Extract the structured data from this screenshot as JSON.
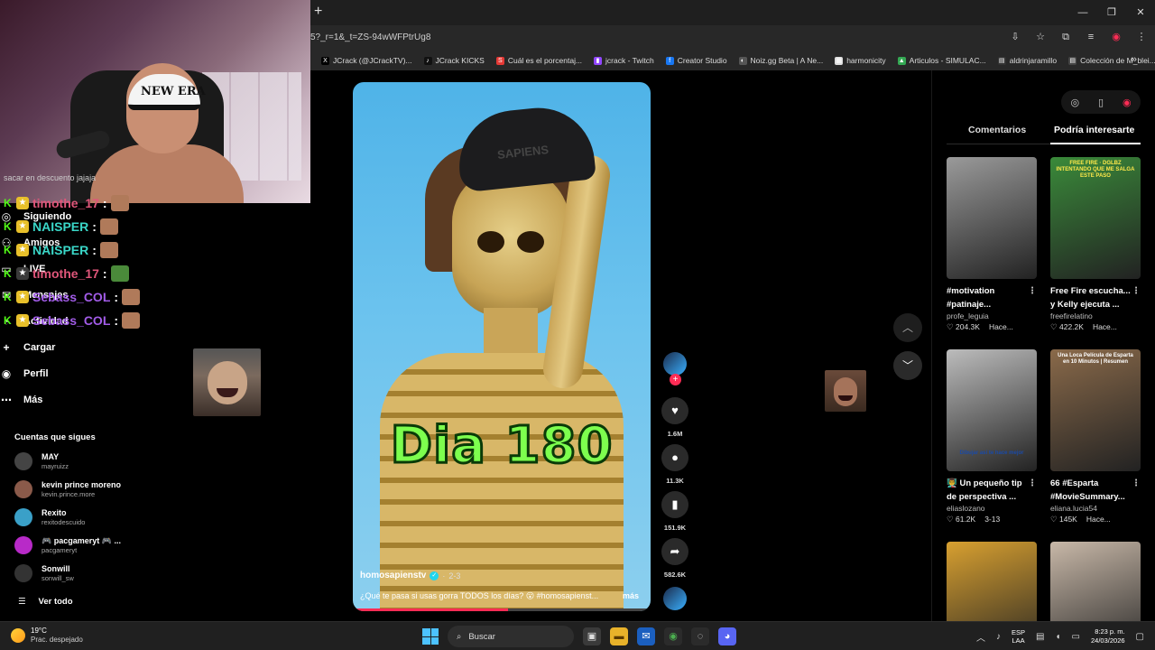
{
  "browser": {
    "url": "5?_r=1&_t=ZS-94wWFPtrUg8",
    "bookmarks": [
      {
        "label": "JCrack (@JCrackTV)...",
        "icon": "x-icon",
        "color": "#000000"
      },
      {
        "label": "JCrack KICKS",
        "icon": "tiktok-icon",
        "color": "#111111"
      },
      {
        "label": "Cuál es el porcentaj...",
        "icon": "s-icon",
        "color": "#e53935"
      },
      {
        "label": "jcrack - Twitch",
        "icon": "twitch-icon",
        "color": "#9146ff"
      },
      {
        "label": "Creator Studio",
        "icon": "facebook-icon",
        "color": "#1877f2"
      },
      {
        "label": "Noiz.gg Beta | A Ne...",
        "icon": "noiz-icon",
        "color": "#555555"
      },
      {
        "label": "harmonicity",
        "icon": "harmonicity-icon",
        "color": "#dddddd"
      },
      {
        "label": "Articulos - SIMULAC...",
        "icon": "drive-icon",
        "color": "#34a853"
      },
      {
        "label": "aldrinjaramillo",
        "icon": "user-icon",
        "color": "#333333"
      },
      {
        "label": "Colección de M_blei...",
        "icon": "doc-icon",
        "color": "#444444"
      }
    ]
  },
  "sidebar": {
    "nav": [
      {
        "label": "Siguiendo",
        "icon": "following-icon"
      },
      {
        "label": "Amigos",
        "icon": "friends-icon"
      },
      {
        "label": "LIVE",
        "icon": "live-icon"
      },
      {
        "label": "Mensajes",
        "icon": "messages-icon"
      },
      {
        "label": "Actividad",
        "icon": "activity-icon"
      },
      {
        "label": "Cargar",
        "icon": "upload-icon"
      },
      {
        "label": "Perfil",
        "icon": "profile-icon"
      },
      {
        "label": "Más",
        "icon": "more-icon"
      }
    ],
    "following_title": "Cuentas que sigues",
    "accounts": [
      {
        "name": "MAY",
        "handle": "mayruizz",
        "color": "#444444"
      },
      {
        "name": "kevin prince moreno",
        "handle": "kevin.prince.more",
        "color": "#8a5a4a"
      },
      {
        "name": "Rexito",
        "handle": "rexitodescuido",
        "color": "#3aa0c8"
      },
      {
        "name": "🎮 pacgameryt 🎮 ...",
        "handle": "pacgameryt",
        "color": "#b82ac8"
      },
      {
        "name": "Sonwill",
        "handle": "sonwill_sw",
        "color": "#333333"
      }
    ],
    "see_all": "Ver todo"
  },
  "chat": {
    "top_line": "sacar en descuento jajaja",
    "messages": [
      {
        "user": "timothe_17",
        "color": "#e0567a"
      },
      {
        "user": "NAISPER",
        "color": "#3ad7c8"
      },
      {
        "user": "NAISPER",
        "color": "#3ad7c8"
      },
      {
        "user": "timothe_17",
        "color": "#e0567a"
      },
      {
        "user": "Sebass_COL",
        "color": "#a25ce8"
      },
      {
        "user": "Sebass_COL",
        "color": "#a25ce8"
      }
    ]
  },
  "video": {
    "overlay_text": "Dia 180",
    "cap_text": "SAPIENS",
    "author": "homosapienstv",
    "date": "2-3",
    "description": "¿Qué te pasa si usas gorra TODOS los días? 😮 #homosapienst...",
    "more": "más",
    "progress": 0.52,
    "likes": "1.6M",
    "comments": "11.3K",
    "saves": "151.9K",
    "shares": "582.6K"
  },
  "right_panel": {
    "tabs": [
      "Comentarios",
      "Podría interesarte"
    ],
    "active_tab": 1,
    "cards": [
      {
        "title": "#motivation #patinaje...",
        "user": "profe_leguia",
        "likes": "204.3K",
        "when": "Hace...",
        "thumb_caption": "",
        "thumb": "#9a9a9a"
      },
      {
        "title": "Free Fire escucha... y Kelly ejecuta ...",
        "user": "freefirelatino",
        "likes": "422.2K",
        "when": "Hace...",
        "thumb_caption": "FREE FIRE · DGLBZ INTENTANDO QUE ME SALGA ESTE PASO",
        "thumb": "#3a8a3a"
      },
      {
        "title": "👨‍🏫 Un pequeño tip de perspectiva ...",
        "user": "eliaslozano",
        "likes": "61.2K",
        "when": "3-13",
        "thumb_caption": "Dibujar así te hace mejor",
        "thumb": "#bcbcbc"
      },
      {
        "title": "66 #Esparta #MovieSummary...",
        "user": "eliana.lucia54",
        "likes": "145K",
        "when": "Hace...",
        "thumb_caption": "Una Loca Película de Esparta en 10 Minutos | Resumen",
        "thumb": "#8a6a4a"
      },
      {
        "title": "",
        "user": "",
        "likes": "",
        "when": "",
        "thumb_caption": "",
        "thumb": "#d8a030"
      },
      {
        "title": "",
        "user": "",
        "likes": "",
        "when": "",
        "thumb_caption": "",
        "thumb": "#c8b8a8"
      }
    ]
  },
  "taskbar": {
    "temp": "19°C",
    "weather": "Prac. despejado",
    "search": "Buscar",
    "lang1": "ESP",
    "lang2": "LAA",
    "time": "8:23 p. m.",
    "date": "24/03/2026"
  }
}
